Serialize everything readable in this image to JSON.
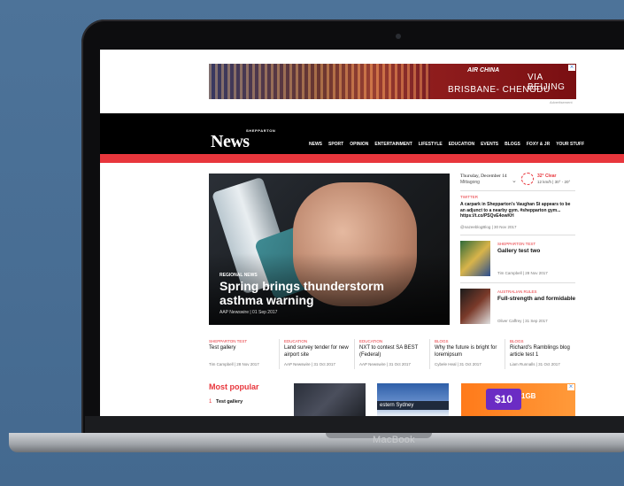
{
  "device": {
    "brand": "MacBook"
  },
  "ad_top": {
    "airline": "AIR CHINA",
    "line1": "VIA BEIJING",
    "line2": "BRISBANE- CHENGDU",
    "caption": "Advertisement",
    "close": "⨯"
  },
  "header": {
    "logo_small": "SHEPPARTON",
    "logo": "News",
    "nav": [
      "NEWS",
      "SPORT",
      "OPINION",
      "ENTERTAINMENT",
      "LIFESTYLE",
      "EDUCATION",
      "EVENTS",
      "BLOGS",
      "FOXY & JR",
      "YOUR STUFF"
    ]
  },
  "hero": {
    "kicker": "REGIONAL NEWS",
    "title": "Spring brings thunderstorm asthma warning",
    "meta": "AAP Newswire | 01 Sep 2017"
  },
  "weather": {
    "date": "Thursday, December 14",
    "place": "Mittagong",
    "temp": "32° Clear",
    "wind": "12 km/h | 30° - 20°"
  },
  "twitter": {
    "label": "TWITTER",
    "text": "A carpark in Shepparton's Vaughan St appears to be an adjunct to a nearby gym. #shepparton gym... https://t.co/PSQvE4owKH",
    "meta": "@nazeeblogBlog | 30 Nov 2017"
  },
  "side_items": [
    {
      "tag": "SHEPPARTON TEST",
      "title": "Gallery test two",
      "meta": "Tim Campbell | 28 Nov 2017"
    },
    {
      "tag": "AUSTRALIAN RULES",
      "title": "Full-strength and formidable",
      "meta": "Oliver Caffrey | 31 Sep 2017"
    }
  ],
  "row_items": [
    {
      "tag": "SHEPPARTON TEST",
      "title": "Test gallery",
      "meta": "Tim Campbell | 28 Nov 2017"
    },
    {
      "tag": "EDUCATION",
      "title": "Land survey tender for new airport site",
      "meta": "AAP Newswire | 31 Oct 2017"
    },
    {
      "tag": "EDUCATION",
      "title": "NXT to contest SA BEST (Federal)",
      "meta": "AAP Newswire | 31 Oct 2017"
    },
    {
      "tag": "BLOGS",
      "title": "Why the future is bright for loremipsum",
      "meta": "Cybele Heal | 31 Oct 2017"
    },
    {
      "tag": "BLOGS",
      "title": "Richard's Ramblings blog article test 1",
      "meta": "Liam Runnalls | 31 Oct 2017"
    }
  ],
  "most_popular": {
    "heading": "Most popular",
    "items": [
      {
        "num": "1",
        "title": "Test gallery"
      }
    ]
  },
  "bottom": {
    "img2_label": "estern Sydney",
    "ad_price": "$10",
    "ad_data": "1GB"
  }
}
